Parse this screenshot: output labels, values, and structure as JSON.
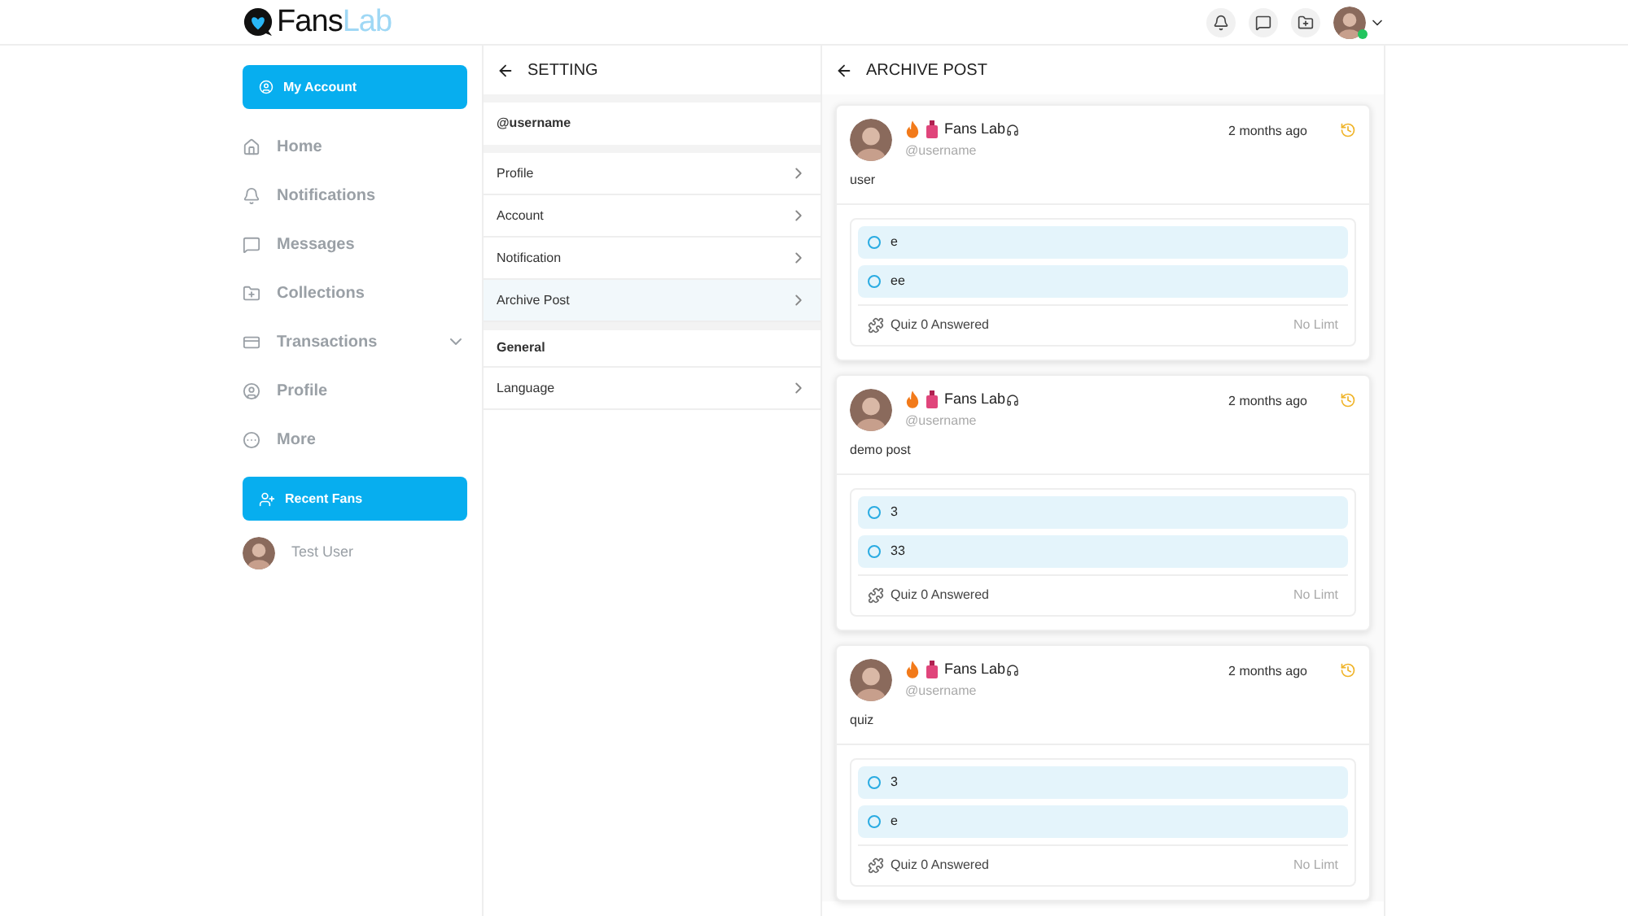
{
  "logo": {
    "main": "Fans",
    "accent": "Lab"
  },
  "sidebar": {
    "account_button": "My Account",
    "items": [
      {
        "label": "Home",
        "expandable": false
      },
      {
        "label": "Notifications",
        "expandable": false
      },
      {
        "label": "Messages",
        "expandable": false
      },
      {
        "label": "Collections",
        "expandable": false
      },
      {
        "label": "Transactions",
        "expandable": true
      },
      {
        "label": "Profile",
        "expandable": false
      },
      {
        "label": "More",
        "expandable": false
      }
    ],
    "recent_fans_button": "Recent Fans",
    "fans": [
      {
        "name": "Test User"
      }
    ]
  },
  "settings": {
    "title": "SETTING",
    "username": "@username",
    "items": [
      {
        "label": "Profile",
        "selected": false
      },
      {
        "label": "Account",
        "selected": false
      },
      {
        "label": "Notification",
        "selected": false
      },
      {
        "label": "Archive Post",
        "selected": true
      }
    ],
    "general_heading": "General",
    "general_items": [
      {
        "label": "Language",
        "selected": false
      }
    ]
  },
  "archive": {
    "title": "ARCHIVE POST",
    "posts": [
      {
        "name": "Fans Lab",
        "handle": "@username",
        "time": "2 months ago",
        "text": "user",
        "options": [
          "e",
          "ee"
        ],
        "quiz": "Quiz 0 Answered",
        "limit": "No Limt"
      },
      {
        "name": "Fans Lab",
        "handle": "@username",
        "time": "2 months ago",
        "text": "demo post",
        "options": [
          "3",
          "33"
        ],
        "quiz": "Quiz 0 Answered",
        "limit": "No Limt"
      },
      {
        "name": "Fans Lab",
        "handle": "@username",
        "time": "2 months ago",
        "text": "quiz",
        "options": [
          "3",
          "e"
        ],
        "quiz": "Quiz 0 Answered",
        "limit": "No Limt"
      }
    ]
  }
}
